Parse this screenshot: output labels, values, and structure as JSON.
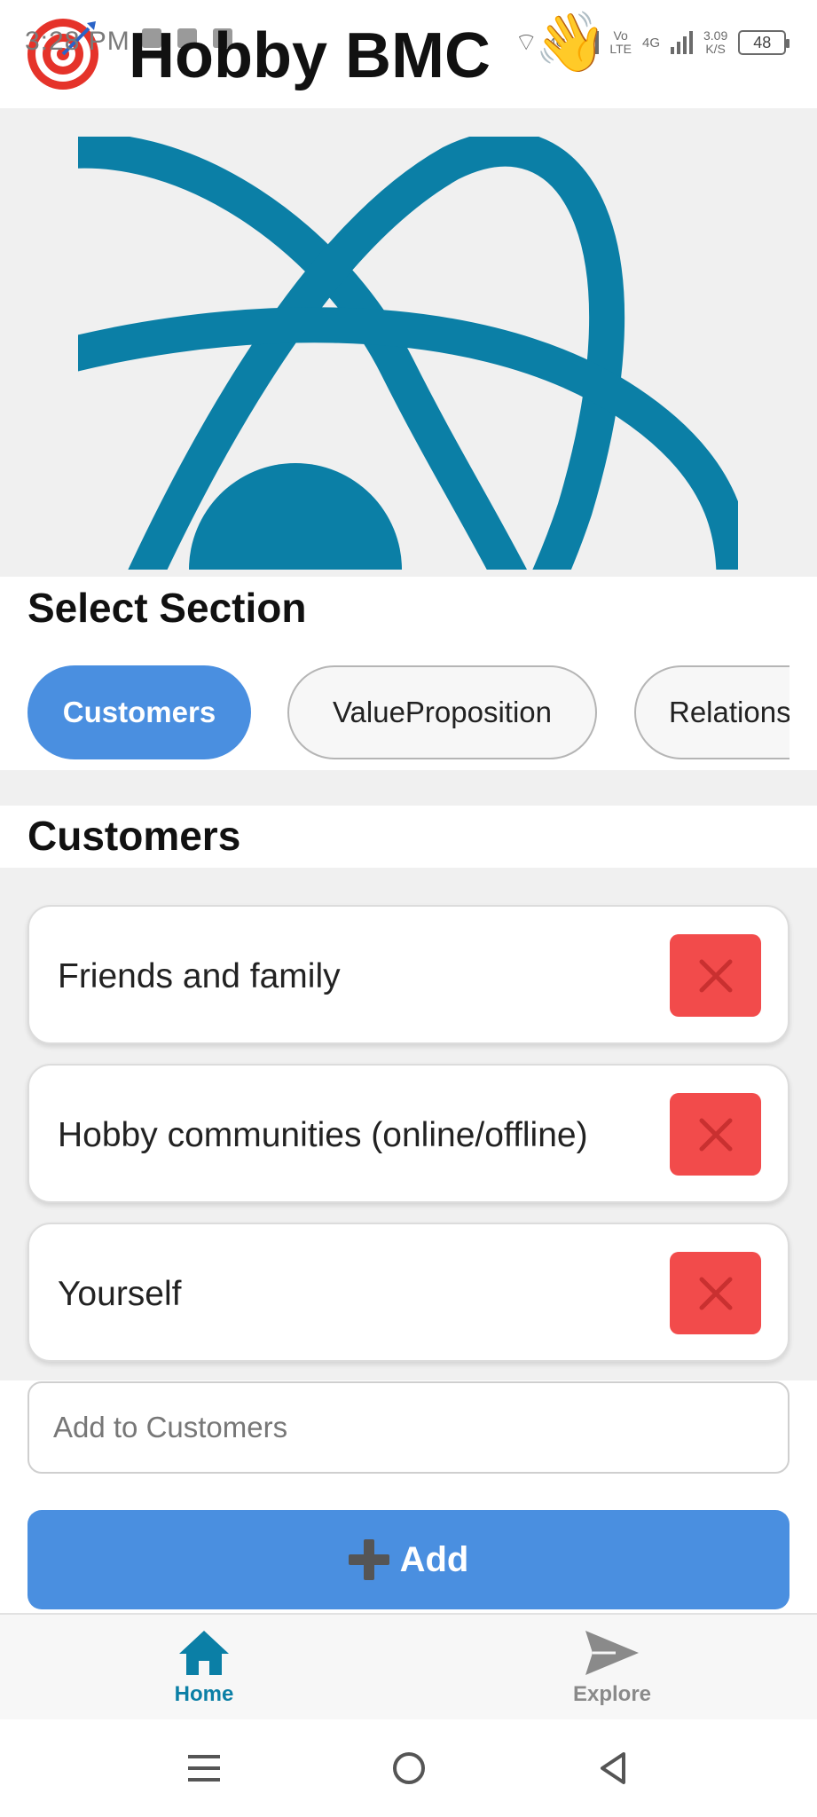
{
  "status_bar": {
    "time": "3:28 PM",
    "network_label": "4G",
    "volte_top": "Vo",
    "volte_bottom": "LTE",
    "network_label_2": "4G",
    "speed_value": "3.09",
    "speed_unit": "K/S",
    "battery": "48"
  },
  "header": {
    "title": "Hobby BMC",
    "wave_emoji": "👋"
  },
  "colors": {
    "brand_teal": "#0b7fa6",
    "accent_blue": "#4a8fe0",
    "delete_red": "#f24b4b"
  },
  "select_section": {
    "title": "Select Section",
    "chips": [
      {
        "label": "Customers",
        "active": true
      },
      {
        "label": "ValueProposition",
        "active": false
      },
      {
        "label": "Relationships",
        "active": false
      }
    ]
  },
  "section": {
    "title": "Customers",
    "items": [
      {
        "text": "Friends and family"
      },
      {
        "text": "Hobby communities (online/offline)"
      },
      {
        "text": "Yourself"
      }
    ],
    "input_placeholder": "Add to Customers",
    "add_button_label": "Add"
  },
  "bottom_nav": {
    "items": [
      {
        "label": "Home",
        "icon": "home-icon",
        "active": true
      },
      {
        "label": "Explore",
        "icon": "send-icon",
        "active": false
      }
    ]
  }
}
